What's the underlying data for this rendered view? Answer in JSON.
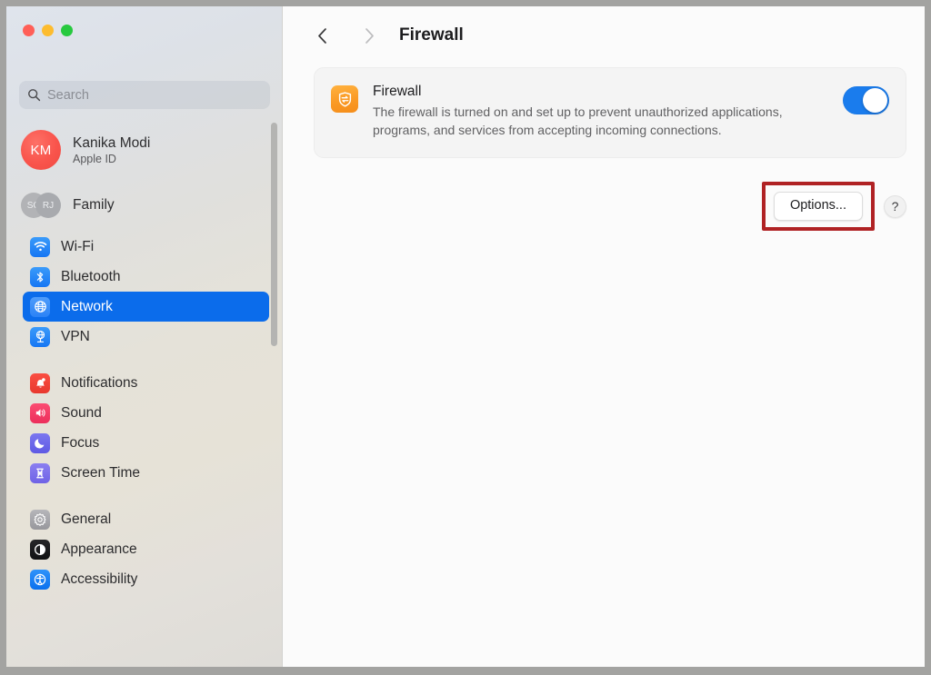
{
  "window": {
    "traffic_lights": [
      {
        "name": "close",
        "color": "#ff5f57"
      },
      {
        "name": "minimize",
        "color": "#fdbc2e"
      },
      {
        "name": "maximize",
        "color": "#27c93f"
      }
    ]
  },
  "sidebar": {
    "search": {
      "placeholder": "Search",
      "value": "",
      "icon": "search-icon"
    },
    "account": {
      "initials": "KM",
      "name": "Kanika Modi",
      "subtitle": "Apple ID",
      "avatar_color": "#f9544c"
    },
    "family": {
      "label": "Family",
      "avatars": [
        "SG",
        "RJ"
      ]
    },
    "groups": [
      {
        "items": [
          {
            "label": "Wi-Fi",
            "icon": "wifi-icon",
            "icon_class": "ic-wifi",
            "selected": false
          },
          {
            "label": "Bluetooth",
            "icon": "bluetooth-icon",
            "icon_class": "ic-bluetooth",
            "selected": false
          },
          {
            "label": "Network",
            "icon": "network-globe-icon",
            "icon_class": "ic-network",
            "selected": true
          },
          {
            "label": "VPN",
            "icon": "vpn-icon",
            "icon_class": "ic-vpn",
            "selected": false
          }
        ]
      },
      {
        "items": [
          {
            "label": "Notifications",
            "icon": "bell-icon",
            "icon_class": "ic-notifications",
            "selected": false
          },
          {
            "label": "Sound",
            "icon": "speaker-icon",
            "icon_class": "ic-sound",
            "selected": false
          },
          {
            "label": "Focus",
            "icon": "moon-icon",
            "icon_class": "ic-focus",
            "selected": false
          },
          {
            "label": "Screen Time",
            "icon": "hourglass-icon",
            "icon_class": "ic-screentime",
            "selected": false
          }
        ]
      },
      {
        "items": [
          {
            "label": "General",
            "icon": "gear-icon",
            "icon_class": "ic-general",
            "selected": false
          },
          {
            "label": "Appearance",
            "icon": "appearance-icon",
            "icon_class": "ic-appearance",
            "selected": false
          },
          {
            "label": "Accessibility",
            "icon": "accessibility-icon",
            "icon_class": "ic-accessibility",
            "selected": false
          }
        ]
      }
    ],
    "selected_item": "Network",
    "selected_color": "#0b6ceb"
  },
  "toolbar": {
    "back_icon": "chevron-left-icon",
    "forward_icon": "chevron-right-icon",
    "back_enabled": true,
    "forward_enabled": false,
    "title": "Firewall"
  },
  "main": {
    "card": {
      "icon": "firewall-shield-icon",
      "icon_color": "#fa9a25",
      "title": "Firewall",
      "description": "The firewall is turned on and set up to prevent unauthorized applications, programs, and services from accepting incoming connections.",
      "toggle": {
        "state": "on",
        "color": "#1a7ced"
      }
    },
    "actions": {
      "options_label": "Options...",
      "help_label": "?",
      "highlight_color": "#b02224",
      "highlighted_element": "options-button"
    }
  }
}
